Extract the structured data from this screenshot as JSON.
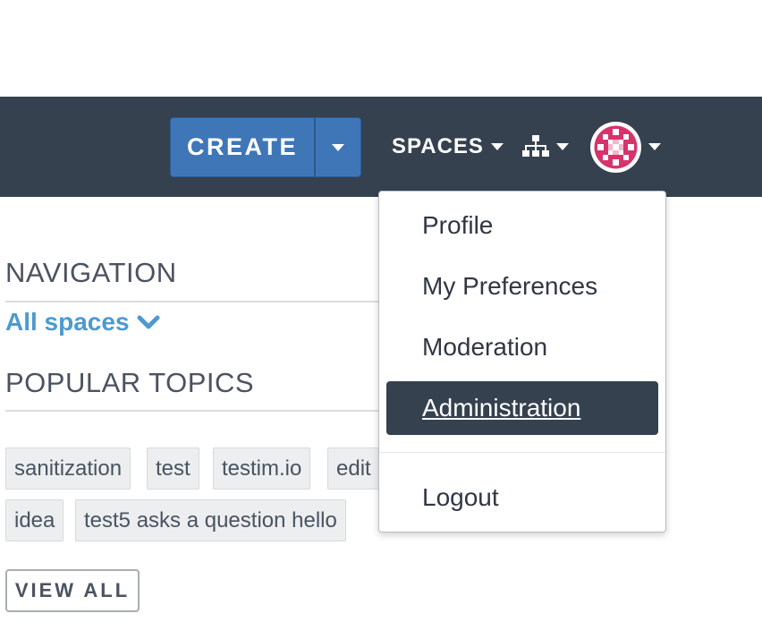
{
  "header": {
    "create_label": "CREATE",
    "spaces_label": "SPACES",
    "tree_icon": "sitemap-icon",
    "avatar_icon": "user-avatar"
  },
  "sidebar": {
    "navigation_heading": "NAVIGATION",
    "all_spaces_label": "All spaces",
    "popular_topics_heading": "POPULAR TOPICS",
    "topics": [
      "sanitization",
      "test",
      "testim.io",
      "edit",
      "idea",
      "test5 asks a question hello"
    ],
    "view_all_label": "VIEW ALL"
  },
  "user_menu": {
    "items": [
      "Profile",
      "My Preferences",
      "Moderation",
      "Administration"
    ],
    "active_item": "Administration",
    "logout_label": "Logout"
  },
  "colors": {
    "topbar": "#35414f",
    "create_button": "#3f76b7",
    "link": "#4c9ad0",
    "avatar_accent": "#d6336c"
  }
}
